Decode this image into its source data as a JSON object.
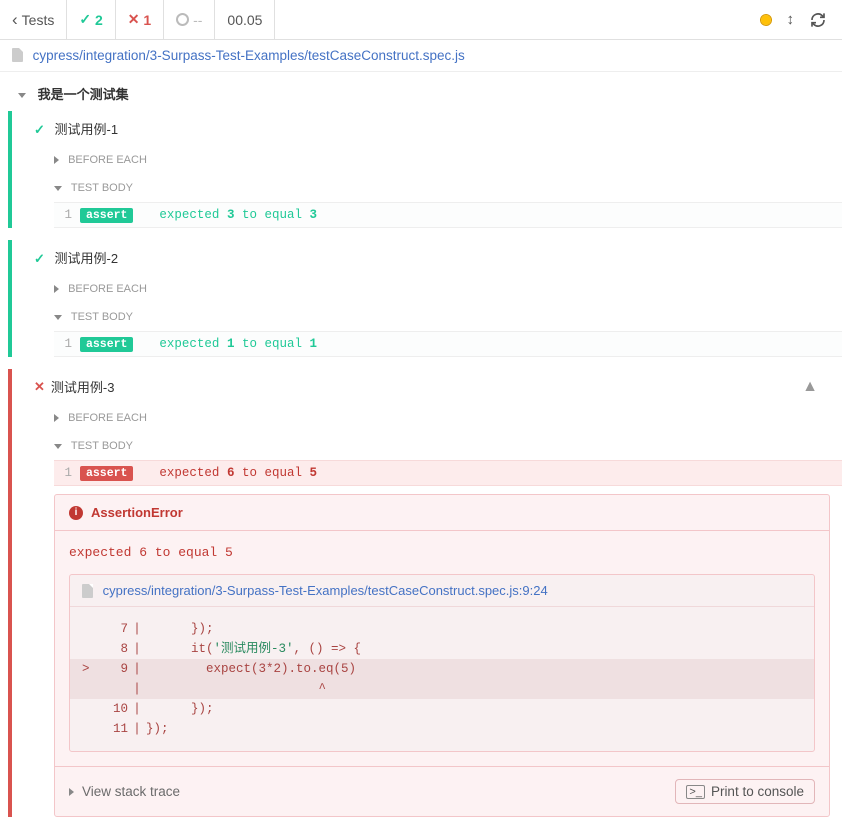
{
  "toolbar": {
    "tests_label": "Tests",
    "pass_count": "2",
    "fail_count": "1",
    "pending_label": "--",
    "time": "00.05"
  },
  "file": {
    "path": "cypress/integration/3-Surpass-Test-Examples/testCaseConstruct.spec.js"
  },
  "suite": {
    "title": "我是一个测试集"
  },
  "tests": [
    {
      "title": "测试用例-1",
      "status": "pass",
      "before_each": "BEFORE EACH",
      "test_body": "TEST BODY",
      "line_no": "1",
      "badge": "assert",
      "msg_pre": "expected ",
      "msg_a": "3",
      "msg_mid": " to equal ",
      "msg_b": "3"
    },
    {
      "title": "测试用例-2",
      "status": "pass",
      "before_each": "BEFORE EACH",
      "test_body": "TEST BODY",
      "line_no": "1",
      "badge": "assert",
      "msg_pre": "expected ",
      "msg_a": "1",
      "msg_mid": " to equal ",
      "msg_b": "1"
    },
    {
      "title": "测试用例-3",
      "status": "fail",
      "before_each": "BEFORE EACH",
      "test_body": "TEST BODY",
      "line_no": "1",
      "badge": "assert",
      "msg_pre": "expected ",
      "msg_a": "6",
      "msg_mid": " to equal ",
      "msg_b": "5"
    }
  ],
  "error": {
    "name": "AssertionError",
    "message": "expected 6 to equal 5",
    "file": "cypress/integration/3-Surpass-Test-Examples/testCaseConstruct.spec.js:9:24",
    "code": [
      {
        "gut": " ",
        "no": "7",
        "txt": "      });",
        "hl": false
      },
      {
        "gut": " ",
        "no": "8",
        "txt": "      it('测试用例-3', () => {",
        "hl": false
      },
      {
        "gut": ">",
        "no": "9",
        "txt": "        expect(3*2).to.eq(5)",
        "hl": true
      },
      {
        "gut": " ",
        "no": " ",
        "txt": "                       ^",
        "hl": true
      },
      {
        "gut": " ",
        "no": "10",
        "txt": "      });",
        "hl": false
      },
      {
        "gut": " ",
        "no": "11",
        "txt": "});",
        "hl": false
      }
    ],
    "stack_label": "View stack trace",
    "print_label": "Print to console"
  }
}
